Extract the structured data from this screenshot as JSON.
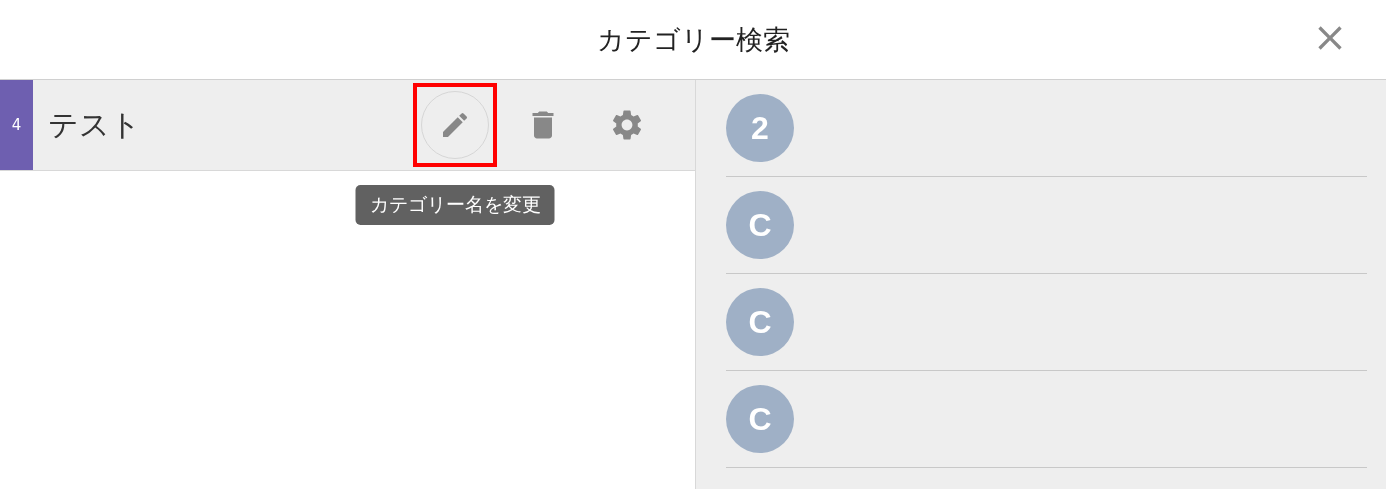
{
  "dialog": {
    "title": "カテゴリー検索"
  },
  "categories": [
    {
      "count": "4",
      "name": "テスト",
      "selected": true,
      "actions": [
        {
          "kind": "edit",
          "hovered": true,
          "highlighted": true,
          "tooltip": "カテゴリー名を変更"
        },
        {
          "kind": "delete",
          "hovered": false,
          "highlighted": false
        },
        {
          "kind": "settings",
          "hovered": false,
          "highlighted": false
        }
      ]
    }
  ],
  "results": [
    {
      "initial": "2"
    },
    {
      "initial": "C"
    },
    {
      "initial": "C"
    },
    {
      "initial": "C"
    }
  ]
}
